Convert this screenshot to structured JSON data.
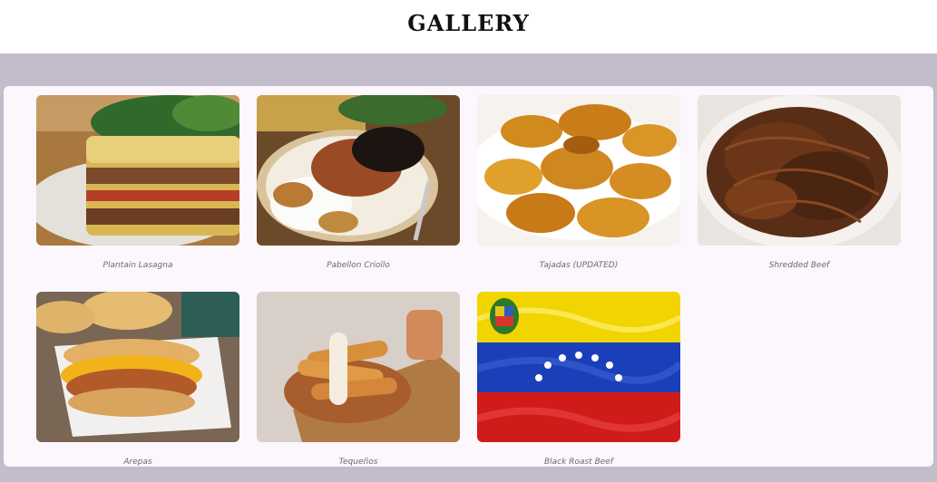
{
  "header": {
    "title": "GALLERY"
  },
  "gallery": {
    "items": [
      {
        "caption": "Plantain Lasagna"
      },
      {
        "caption": "Pabellon Criollo"
      },
      {
        "caption": "Tajadas (UPDATED)"
      },
      {
        "caption": "Shredded Beef"
      },
      {
        "caption": "Arepas"
      },
      {
        "caption": "Tequeños"
      },
      {
        "caption": "Black Roast Beef"
      }
    ]
  },
  "colors": {
    "page_background": "#c2bccb",
    "panel_background": "#fcf6fd",
    "header_background": "#ffffff",
    "flag_yellow": "#f2d400",
    "flag_blue": "#1a3fb8",
    "flag_red": "#d01b1b"
  }
}
